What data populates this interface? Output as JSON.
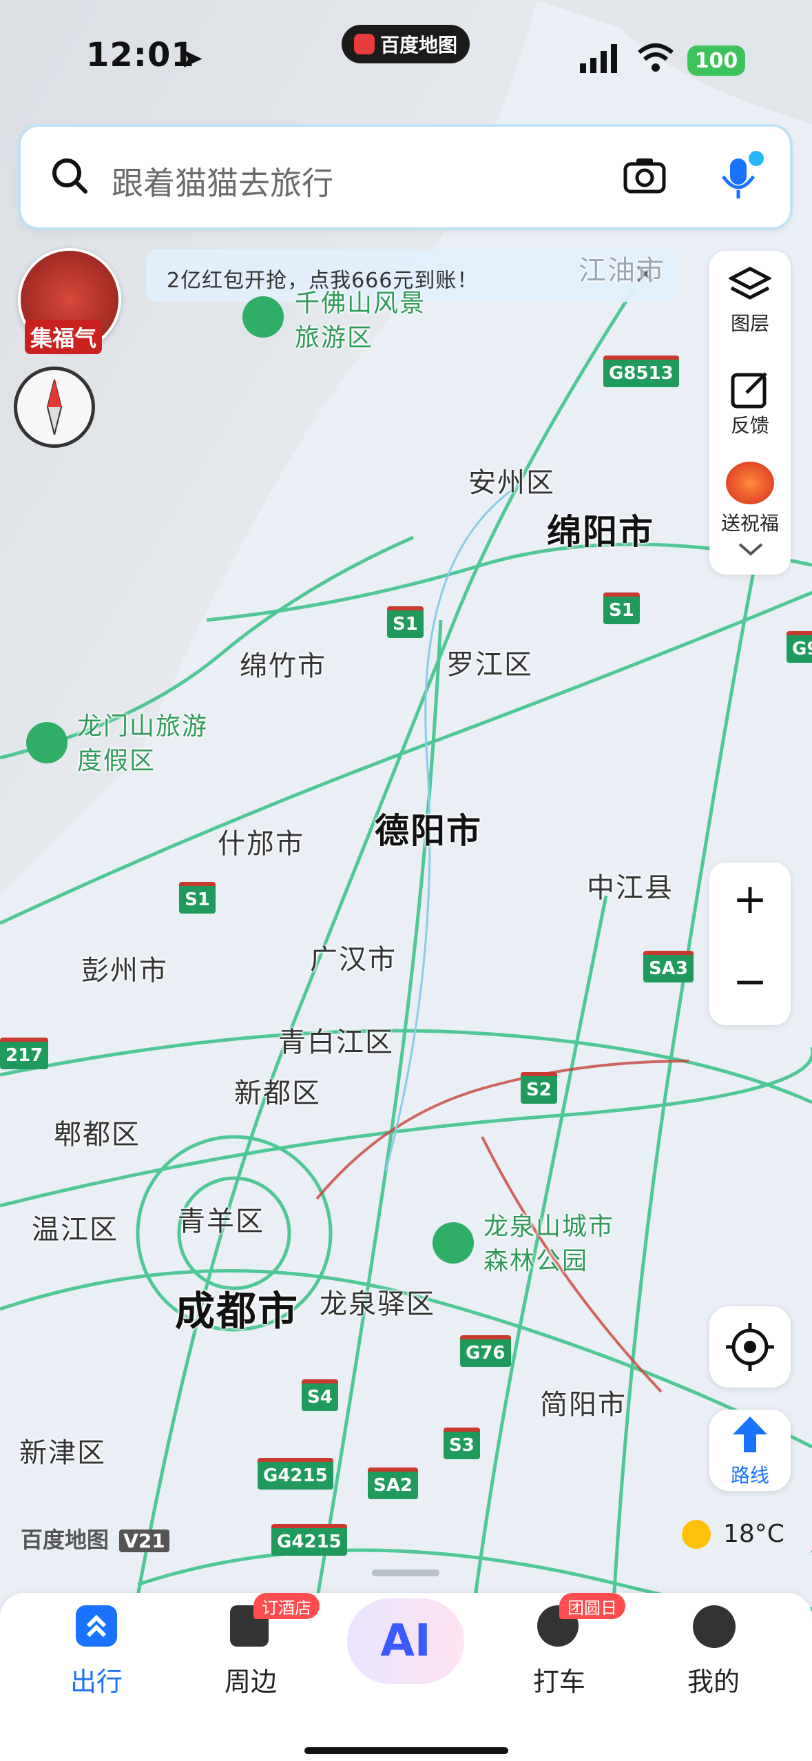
{
  "status_bar": {
    "time": "12:01",
    "app_pill": "百度地图",
    "battery": "100"
  },
  "search": {
    "placeholder": "跟着猫猫去旅行",
    "icons": [
      "search-icon",
      "camera-icon",
      "microphone-icon"
    ]
  },
  "promo": {
    "avatar_tag": "集福气",
    "banner_text": "2亿红包开抢，点我666元到账！",
    "close": "✕"
  },
  "side_panel": {
    "layers": "图层",
    "feedback": "反馈",
    "blessing": "送祝福"
  },
  "zoom": {
    "in": "+",
    "out": "−"
  },
  "route_button": {
    "label": "路线"
  },
  "weather": {
    "temp": "18°C"
  },
  "map_logo": {
    "text": "百度地图",
    "version": "V21"
  },
  "map": {
    "cities_major": [
      "绵阳市",
      "德阳市",
      "成都市"
    ],
    "districts": [
      "安州区",
      "罗江区",
      "绵竹市",
      "什邡市",
      "中江县",
      "彭州市",
      "广汉市",
      "青白江区",
      "新都区",
      "郫都区",
      "温江区",
      "青羊区",
      "龙泉驿区",
      "简阳市",
      "新津区",
      "江油市"
    ],
    "pois": [
      {
        "name_line1": "千佛山风景",
        "name_line2": "旅游区"
      },
      {
        "name_line1": "龙门山旅游",
        "name_line2": "度假区"
      },
      {
        "name_line1": "龙泉山城市",
        "name_line2": "森林公园"
      }
    ],
    "shields": [
      "G8513",
      "S1",
      "S1",
      "S1",
      "SA3",
      "S2",
      "G76",
      "S4",
      "S3",
      "G4215",
      "SA2",
      "G4215",
      "217",
      "G9"
    ]
  },
  "tabbar": {
    "items": [
      {
        "label": "出行",
        "active": true
      },
      {
        "label": "周边",
        "badge": "订酒店"
      },
      {
        "label": "AI"
      },
      {
        "label": "打车",
        "badge": "团圆日"
      },
      {
        "label": "我的"
      }
    ]
  },
  "colors": {
    "road": "#3fc38c",
    "accent": "#1a73ff",
    "badge": "#ff4d4f",
    "highway_shield": "#1f9a5c"
  }
}
